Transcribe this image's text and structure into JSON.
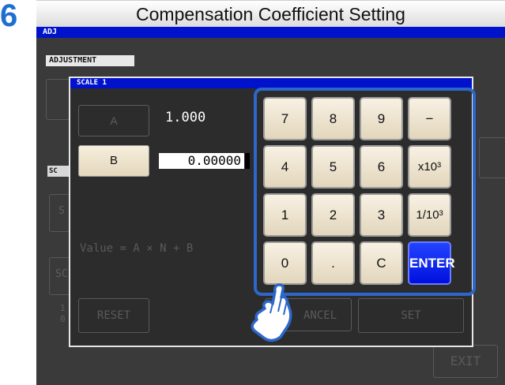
{
  "step_number": "6",
  "header_title": "Compensation Coefficient Setting",
  "screen": {
    "title": "ADJ",
    "adjustment_tab": "ADJUSTMENT",
    "side_tab": "SC",
    "background_label": "S",
    "background_label_2": "SC",
    "bg_digit_1": "1",
    "bg_digit_2": "0",
    "exit_label": "EXIT"
  },
  "dialog": {
    "title": "SCALE 1",
    "a_label": "A",
    "a_value": "1.000",
    "b_label": "B",
    "b_value": "0.00000",
    "formula": "Value = A × N + B",
    "reset_label": "RESET",
    "cancel_label": "ANCEL",
    "set_label": "SET"
  },
  "keypad": {
    "keys": [
      "7",
      "8",
      "9",
      "−",
      "4",
      "5",
      "6",
      "x10³",
      "1",
      "2",
      "3",
      "1/10³",
      "0",
      ".",
      "C",
      "ENTER"
    ]
  },
  "colors": {
    "accent_blue": "#1f6fd1",
    "titlebar_blue": "#0012cc",
    "keypad_border": "#2c67c9",
    "key_face": "#f2eadb"
  },
  "icons": {
    "pointer": "hand-pointer-icon"
  }
}
